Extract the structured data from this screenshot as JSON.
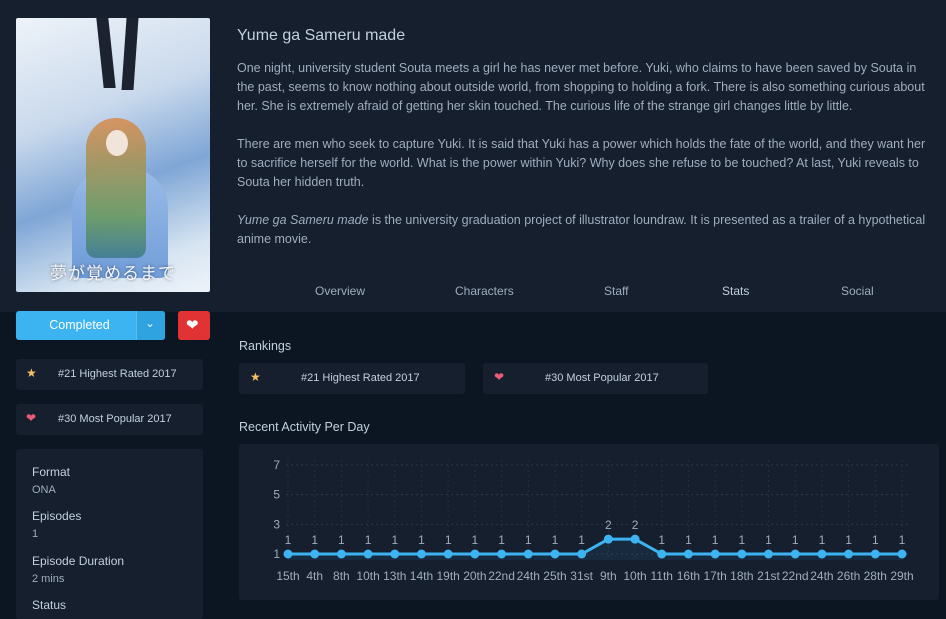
{
  "anime": {
    "title": "Yume ga Sameru made",
    "cover_text": "夢が覚めるまで",
    "description": [
      "One night, university student Souta meets a girl he has never met before. Yuki, who claims to have been saved by Souta in the past, seems to know nothing about outside world, from shopping to holding a fork. There is also something curious about her. She is extremely afraid of getting her skin touched. The curious life of the strange girl changes little by little.",
      "There are men who seek to capture Yuki. It is said that Yuki has a power which holds the fate of the world, and they want her to sacrifice herself for the world. What is the power within Yuki? Why does she refuse to be touched? At last, Yuki reveals to Souta her hidden truth."
    ],
    "description_italic": "Yume ga Sameru made",
    "description_tail": " is the university graduation project of illustrator loundraw. It is presented as a trailer of a hypothetical anime movie."
  },
  "tabs": [
    "Overview",
    "Characters",
    "Staff",
    "Stats",
    "Social"
  ],
  "actions": {
    "status_label": "Completed",
    "dropdown_icon": "chevron-down-icon",
    "favourite_icon": "heart-icon"
  },
  "sidebar": {
    "rank_highest": "#21 Highest Rated 2017",
    "rank_popular": "#30 Most Popular 2017",
    "info": [
      {
        "key": "Format",
        "value": "ONA"
      },
      {
        "key": "Episodes",
        "value": "1"
      },
      {
        "key": "Episode Duration",
        "value": "2 mins"
      },
      {
        "key": "Status",
        "value": ""
      }
    ]
  },
  "rankings": {
    "title": "Rankings",
    "items": [
      {
        "icon": "star-icon",
        "label": "#21 Highest Rated 2017"
      },
      {
        "icon": "heart-icon",
        "label": "#30 Most Popular 2017"
      }
    ]
  },
  "activity": {
    "title": "Recent Activity Per Day"
  },
  "colors": {
    "accent": "#3db4f2",
    "favourite": "#e13333",
    "star": "#f7bf63",
    "heart": "#e85d75",
    "background": "#0b1622",
    "panel": "#151f2e"
  },
  "chart_data": {
    "type": "area",
    "categories": [
      "15th",
      "4th",
      "8th",
      "10th",
      "13th",
      "14th",
      "19th",
      "20th",
      "22nd",
      "24th",
      "25th",
      "31st",
      "9th",
      "10th",
      "11th",
      "16th",
      "17th",
      "18th",
      "21st",
      "22nd",
      "24th",
      "26th",
      "28th",
      "29th"
    ],
    "values": [
      1,
      1,
      1,
      1,
      1,
      1,
      1,
      1,
      1,
      1,
      1,
      1,
      2,
      2,
      1,
      1,
      1,
      1,
      1,
      1,
      1,
      1,
      1,
      1
    ],
    "y_ticks": [
      1,
      3,
      5,
      7
    ],
    "ylim": [
      0,
      7
    ],
    "grid": true,
    "data_labels": true
  }
}
